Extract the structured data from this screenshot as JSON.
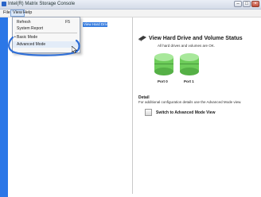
{
  "window": {
    "title": "Intel(R) Matrix Storage Console",
    "controls": {
      "minimize": "–",
      "maximize": "□",
      "close": "×"
    }
  },
  "menubar": {
    "items": [
      "File",
      "View",
      "Help"
    ],
    "active": "View"
  },
  "view_menu": {
    "items": [
      {
        "label": "Refresh",
        "shortcut": "F5"
      },
      {
        "label": "System Report",
        "shortcut": ""
      },
      {
        "label": "Basic Mode",
        "shortcut": "",
        "selected": true
      },
      {
        "label": "Advanced Mode",
        "shortcut": ""
      }
    ]
  },
  "tree": {
    "selected_item": "View Hard Drives"
  },
  "main": {
    "heading": "View Hard Drive and Volume Status",
    "subtext": "All hard drives and volumes are OK.",
    "ports": [
      "Port 0",
      "Port 1"
    ],
    "detail_label": "Detail",
    "detail_text": "For additional configuration details use the Advanced Mode view.",
    "switch_label": "Switch to Advanced Mode View"
  },
  "colors": {
    "accent": "#2b77e7",
    "disk_green": "#6dcc5a",
    "highlight_ring": "#2f6fd8"
  },
  "icons": {
    "app": "app-icon",
    "header": "hard-drive-icon",
    "switch": "switch-mode-icon",
    "cursor": "mouse-cursor-icon"
  }
}
